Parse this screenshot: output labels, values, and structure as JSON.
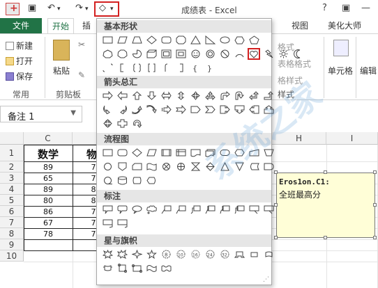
{
  "window": {
    "title": "成绩表 - Excel",
    "help": "?",
    "ribbon_toggle": "▣",
    "minimize": "—"
  },
  "quick_access": {
    "undo": "↶",
    "redo": "↷",
    "dropdown": "▾",
    "shapes_button": "◇"
  },
  "tabs": {
    "file": "文件",
    "home": "开始",
    "insert_partial": "插",
    "view": "视图",
    "beautify": "美化大师"
  },
  "ribbon": {
    "new": "新建",
    "open": "打开",
    "save": "保存",
    "paste": "粘贴",
    "group_common": "常用",
    "group_clipboard": "剪贴板",
    "format_a": "格式",
    "format_b": "表格格式",
    "format_c": "格样式",
    "format_group": "样式",
    "cells": "单元格",
    "edit": "编辑"
  },
  "name_box": {
    "value": "备注 1"
  },
  "grid": {
    "columns": [
      "C",
      "H",
      "I"
    ],
    "rows": [
      "1",
      "2",
      "3",
      "4",
      "5",
      "6",
      "7",
      "8",
      "9",
      "10"
    ],
    "header_c": "数学",
    "header_d_partial": "物",
    "values_c": [
      "89",
      "65",
      "89",
      "80",
      "86",
      "67",
      "78"
    ],
    "values_d_partial": [
      "7",
      "7",
      "8",
      "8",
      "7",
      "7",
      "7"
    ]
  },
  "comment": {
    "author": "Eros1on.C1:",
    "text": "全班最高分"
  },
  "shapes_menu": {
    "sections": [
      {
        "title": "基本形状"
      },
      {
        "title": "箭头总汇"
      },
      {
        "title": "流程图"
      },
      {
        "title": "标注"
      },
      {
        "title": "星与旗帜"
      }
    ],
    "selected_shape": "heart"
  },
  "watermark": "系统之家"
}
